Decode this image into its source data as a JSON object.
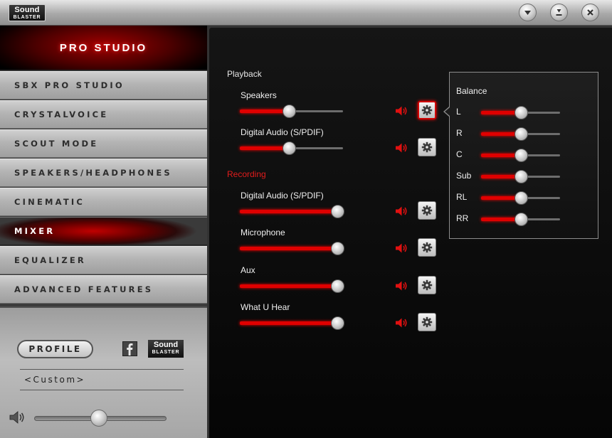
{
  "titlebar": {
    "logo_line1": "Sound",
    "logo_line2": "BLASTER",
    "buttons": [
      "chevron-down-icon",
      "minimize-icon",
      "close-icon"
    ]
  },
  "sidebar": {
    "header": "PRO STUDIO",
    "items": [
      {
        "label": "SBX PRO STUDIO",
        "active": false
      },
      {
        "label": "CRYSTALVOICE",
        "active": false
      },
      {
        "label": "SCOUT MODE",
        "active": false
      },
      {
        "label": "SPEAKERS/HEADPHONES",
        "active": false
      },
      {
        "label": "CINEMATIC",
        "active": false
      },
      {
        "label": "MIXER",
        "active": true
      },
      {
        "label": "EQUALIZER",
        "active": false
      },
      {
        "label": "ADVANCED FEATURES",
        "active": false
      }
    ],
    "profile_button": "PROFILE",
    "sb_logo_line1": "Sound",
    "sb_logo_line2": "BLASTER",
    "profile_name": "<Custom>",
    "master_volume": 0.49
  },
  "mixer": {
    "playback_label": "Playback",
    "recording_label": "Recording",
    "playback": [
      {
        "name": "Speakers",
        "level": 0.5,
        "gear_selected": true
      },
      {
        "name": "Digital Audio (S/PDIF)",
        "level": 0.5,
        "gear_selected": false
      }
    ],
    "recording": [
      {
        "name": "Digital Audio (S/PDIF)",
        "level": 1.0
      },
      {
        "name": "Microphone",
        "level": 1.0
      },
      {
        "name": "Aux",
        "level": 1.0
      },
      {
        "name": "What U Hear",
        "level": 1.0
      }
    ]
  },
  "balance": {
    "title": "Balance",
    "channels": [
      {
        "name": "L",
        "level": 0.5
      },
      {
        "name": "R",
        "level": 0.5
      },
      {
        "name": "C",
        "level": 0.5
      },
      {
        "name": "Sub",
        "level": 0.5
      },
      {
        "name": "RL",
        "level": 0.5
      },
      {
        "name": "RR",
        "level": 0.5
      }
    ]
  },
  "colors": {
    "accent": "#e00000",
    "recording_label": "#e11c1c"
  }
}
